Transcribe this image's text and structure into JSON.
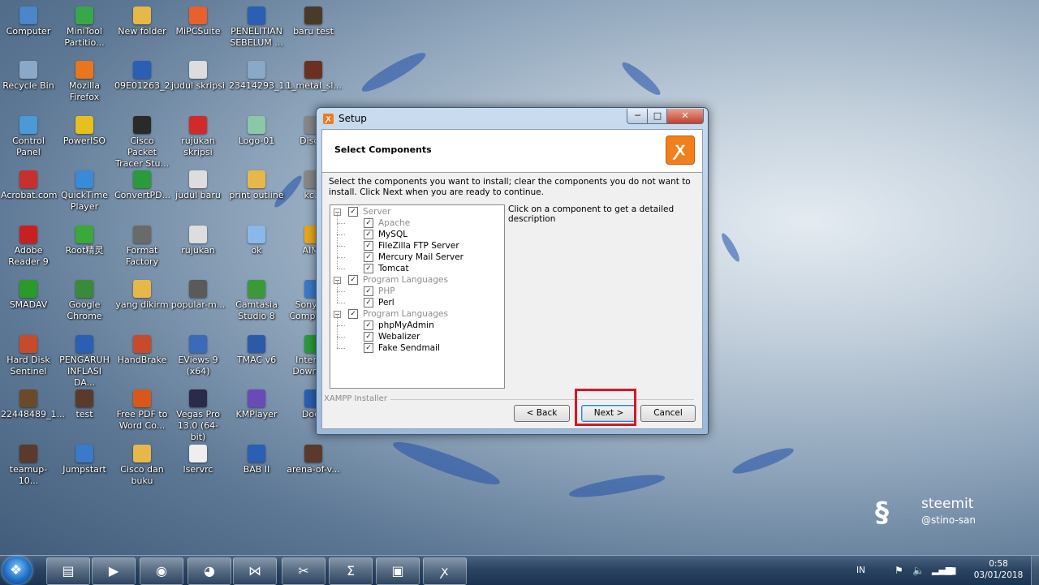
{
  "desktop_icons": [
    {
      "label": "Computer",
      "icon": "computer-icon",
      "color": "#4a86c8"
    },
    {
      "label": "MiniTool Partitio...",
      "icon": "minitool-icon",
      "color": "#3aa64a"
    },
    {
      "label": "New folder",
      "icon": "folder-icon",
      "color": "#e6b84a"
    },
    {
      "label": "MiPCSuite",
      "icon": "mipcsuite-icon",
      "color": "#e8602c"
    },
    {
      "label": "PENELITIAN SEBELUM ...",
      "icon": "word-doc-icon",
      "color": "#2b5fb4"
    },
    {
      "label": "baru test",
      "icon": "video-file-icon",
      "color": "#4a3a2a"
    },
    {
      "label": "Recycle Bin",
      "icon": "recycle-bin-icon",
      "color": "#8aa8c8"
    },
    {
      "label": "Mozilla Firefox",
      "icon": "firefox-icon",
      "color": "#e8761c"
    },
    {
      "label": "09E01263_2",
      "icon": "word-doc-icon",
      "color": "#2b5fb4"
    },
    {
      "label": "judul skripsi",
      "icon": "text-file-icon",
      "color": "#dddddd"
    },
    {
      "label": "23414293_1...",
      "icon": "image-file-icon",
      "color": "#8aa8c8"
    },
    {
      "label": "1_metal_sl...",
      "icon": "video-file-icon",
      "color": "#6a3020"
    },
    {
      "label": "Control Panel",
      "icon": "control-panel-icon",
      "color": "#4a9ad8"
    },
    {
      "label": "PowerISO",
      "icon": "poweriso-icon",
      "color": "#e8c01c"
    },
    {
      "label": "Cisco Packet Tracer Stu...",
      "icon": "cisco-packet-tracer-icon",
      "color": "#2a2a2a"
    },
    {
      "label": "rujukan skripsi",
      "icon": "pdf-file-icon",
      "color": "#d02a2a"
    },
    {
      "label": "Logo-01",
      "icon": "image-file-icon",
      "color": "#8ac8a8"
    },
    {
      "label": "Disc...",
      "icon": "disc-icon",
      "color": "#888888"
    },
    {
      "label": "Acrobat.com",
      "icon": "acrobat-icon",
      "color": "#c83030"
    },
    {
      "label": "QuickTime Player",
      "icon": "quicktime-icon",
      "color": "#3a8ad8"
    },
    {
      "label": "ConvertPD...",
      "icon": "convertpdf-icon",
      "color": "#2a9a3a"
    },
    {
      "label": "judul baru",
      "icon": "text-file-icon",
      "color": "#dddddd"
    },
    {
      "label": "print outline",
      "icon": "folder-icon",
      "color": "#e6b84a"
    },
    {
      "label": "kc...",
      "icon": "file-icon",
      "color": "#888888"
    },
    {
      "label": "Adobe Reader 9",
      "icon": "adobe-reader-icon",
      "color": "#c82020"
    },
    {
      "label": "Root精灵",
      "icon": "root-icon",
      "color": "#3aa83a"
    },
    {
      "label": "Format Factory",
      "icon": "format-factory-icon",
      "color": "#6a6a6a"
    },
    {
      "label": "rujukan",
      "icon": "text-file-icon",
      "color": "#dddddd"
    },
    {
      "label": "ok",
      "icon": "image-file-icon",
      "color": "#8ab8e8"
    },
    {
      "label": "AIMP",
      "icon": "aimp-icon",
      "color": "#e8a81c"
    },
    {
      "label": "SMADAV",
      "icon": "smadav-icon",
      "color": "#2a9a2a"
    },
    {
      "label": "Google Chrome",
      "icon": "chrome-icon",
      "color": "#3a8a3a"
    },
    {
      "label": "yang dikirm",
      "icon": "folder-icon",
      "color": "#e6b84a"
    },
    {
      "label": "popular-m...",
      "icon": "video-file-icon",
      "color": "#5a5a5a"
    },
    {
      "label": "Camtasia Studio 8",
      "icon": "camtasia-icon",
      "color": "#3a9a3a"
    },
    {
      "label": "Sony PC Compani...",
      "icon": "sony-icon",
      "color": "#3a7ac8"
    },
    {
      "label": "Hard Disk Sentinel",
      "icon": "hard-disk-sentinel-icon",
      "color": "#c84a2a"
    },
    {
      "label": "PENGARUH INFLASI DA...",
      "icon": "word-doc-icon",
      "color": "#2b5fb4"
    },
    {
      "label": "HandBrake",
      "icon": "handbrake-icon",
      "color": "#c84a2a"
    },
    {
      "label": "EViews 9 (x64)",
      "icon": "eviews-icon",
      "color": "#3a6ab8"
    },
    {
      "label": "TMAC v6",
      "icon": "tmac-icon",
      "color": "#2a5aa8"
    },
    {
      "label": "Internet Downlo...",
      "icon": "internet-download-icon",
      "color": "#2a9a3a"
    },
    {
      "label": "22448489_1...",
      "icon": "image-file-icon",
      "color": "#6a4a2a"
    },
    {
      "label": "test",
      "icon": "video-file-icon",
      "color": "#5a3a2a"
    },
    {
      "label": "Free PDF to Word Co...",
      "icon": "pdf-to-word-icon",
      "color": "#d8581c"
    },
    {
      "label": "Vegas Pro 13.0 (64-bit)",
      "icon": "vegas-icon",
      "color": "#2a2a4a"
    },
    {
      "label": "KMPlayer",
      "icon": "kmplayer-icon",
      "color": "#6a4ab8"
    },
    {
      "label": "Doc1",
      "icon": "word-doc-icon",
      "color": "#2b5fb4"
    },
    {
      "label": "teamup-10...",
      "icon": "video-file-icon",
      "color": "#5a3a2a"
    },
    {
      "label": "Jumpstart",
      "icon": "jumpstart-icon",
      "color": "#3a7ac8"
    },
    {
      "label": "Cisco dan buku",
      "icon": "folder-icon",
      "color": "#e6b84a"
    },
    {
      "label": "lservrc",
      "icon": "file-icon",
      "color": "#eeeeee"
    },
    {
      "label": "BAB II",
      "icon": "word-doc-icon",
      "color": "#2b5fb4"
    },
    {
      "label": "arena-of-v...",
      "icon": "video-file-icon",
      "color": "#5a3a2a"
    }
  ],
  "window": {
    "title": "Setup",
    "minimize": "─",
    "maximize": "□",
    "close": "✕",
    "header_title": "Select Components",
    "logo_glyph": "ꭗ",
    "instructions": "Select the components you want to install; clear the components you do not want to install. Click Next when you are ready to continue.",
    "description": "Click on a component to get a detailed description",
    "tree": [
      {
        "label": "Server",
        "level": 0,
        "checked": true,
        "grey": true
      },
      {
        "label": "Apache",
        "level": 1,
        "checked": true,
        "grey": true
      },
      {
        "label": "MySQL",
        "level": 1,
        "checked": true,
        "grey": false
      },
      {
        "label": "FileZilla FTP Server",
        "level": 1,
        "checked": true,
        "grey": false
      },
      {
        "label": "Mercury Mail Server",
        "level": 1,
        "checked": true,
        "grey": false
      },
      {
        "label": "Tomcat",
        "level": 1,
        "checked": true,
        "grey": false
      },
      {
        "label": "Program Languages",
        "level": 0,
        "checked": true,
        "grey": true
      },
      {
        "label": "PHP",
        "level": 1,
        "checked": true,
        "grey": true
      },
      {
        "label": "Perl",
        "level": 1,
        "checked": true,
        "grey": false
      },
      {
        "label": "Program Languages",
        "level": 0,
        "checked": true,
        "grey": true
      },
      {
        "label": "phpMyAdmin",
        "level": 1,
        "checked": true,
        "grey": false
      },
      {
        "label": "Webalizer",
        "level": 1,
        "checked": true,
        "grey": false
      },
      {
        "label": "Fake Sendmail",
        "level": 1,
        "checked": true,
        "grey": false
      }
    ],
    "installer_label": "XAMPP Installer",
    "back_label": "< Back",
    "next_label": "Next >",
    "cancel_label": "Cancel"
  },
  "taskbar": {
    "start_glyph": "❖",
    "apps": [
      {
        "name": "explorer-app",
        "glyph": "▤"
      },
      {
        "name": "media-player-app",
        "glyph": "▶"
      },
      {
        "name": "chrome-app",
        "glyph": "◉"
      },
      {
        "name": "firefox-app",
        "glyph": "◕"
      },
      {
        "name": "kmplayer-app",
        "glyph": "⋈"
      },
      {
        "name": "snipping-tool-app",
        "glyph": "✂"
      },
      {
        "name": "eviews-app",
        "glyph": "Σ"
      },
      {
        "name": "window-app",
        "glyph": "▣"
      },
      {
        "name": "xampp-app",
        "glyph": "ꭗ"
      }
    ],
    "language": "IN",
    "time": "0:58",
    "date": "03/01/2018"
  },
  "watermark": {
    "name": "steemit",
    "user": "@stino-san",
    "logo_glyph": "§"
  }
}
